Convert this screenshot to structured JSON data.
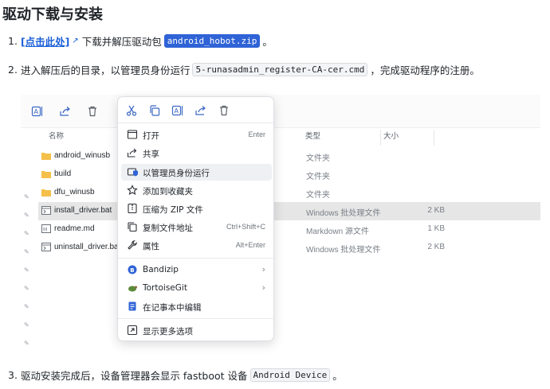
{
  "heading": "驱动下载与安装",
  "steps": {
    "s1": {
      "num": "1.",
      "link": "[点击此处]",
      "text": "下载并解压驱动包",
      "code": "android_hobot.zip",
      "end": "。"
    },
    "s2": {
      "num": "2.",
      "text": "进入解压后的目录，以管理员身份运行",
      "code": "5-runasadmin_register-CA-cer.cmd",
      "end": "，完成驱动程序的注册。"
    },
    "s3": {
      "num": "3.",
      "text": "驱动安装完成后，设备管理器会显示 fastboot 设备",
      "code": "Android Device",
      "end": "。"
    }
  },
  "explorer": {
    "columns": {
      "name": "名称",
      "type": "类型",
      "size": "大小"
    },
    "files": [
      {
        "name": "android_winusb",
        "type": "文件夹",
        "size": ""
      },
      {
        "name": "build",
        "type": "文件夹",
        "size": ""
      },
      {
        "name": "dfu_winusb",
        "type": "文件夹",
        "size": ""
      },
      {
        "name": "install_driver.bat",
        "type": "Windows 批处理文件",
        "size": "2 KB"
      },
      {
        "name": "readme.md",
        "type": "Markdown 源文件",
        "size": "1 KB"
      },
      {
        "name": "uninstall_driver.bat",
        "type": "Windows 批处理文件",
        "size": "2 KB"
      }
    ]
  },
  "context_menu": {
    "items": [
      {
        "label": "打开",
        "shortcut": "Enter"
      },
      {
        "label": "共享",
        "shortcut": ""
      },
      {
        "label": "以管理员身份运行",
        "shortcut": ""
      },
      {
        "label": "添加到收藏夹",
        "shortcut": ""
      },
      {
        "label": "压缩为 ZIP 文件",
        "shortcut": ""
      },
      {
        "label": "复制文件地址",
        "shortcut": "Ctrl+Shift+C"
      },
      {
        "label": "属性",
        "shortcut": "Alt+Enter"
      }
    ],
    "extras": [
      {
        "label": "Bandizip",
        "arrow": "›"
      },
      {
        "label": "TortoiseGit",
        "arrow": "›"
      },
      {
        "label": "在记事本中编辑",
        "arrow": ""
      }
    ],
    "more": "显示更多选项"
  },
  "colors": {
    "link": "#1a5fd8",
    "selection": "#2f63d6",
    "folder": "#f5c04a"
  }
}
